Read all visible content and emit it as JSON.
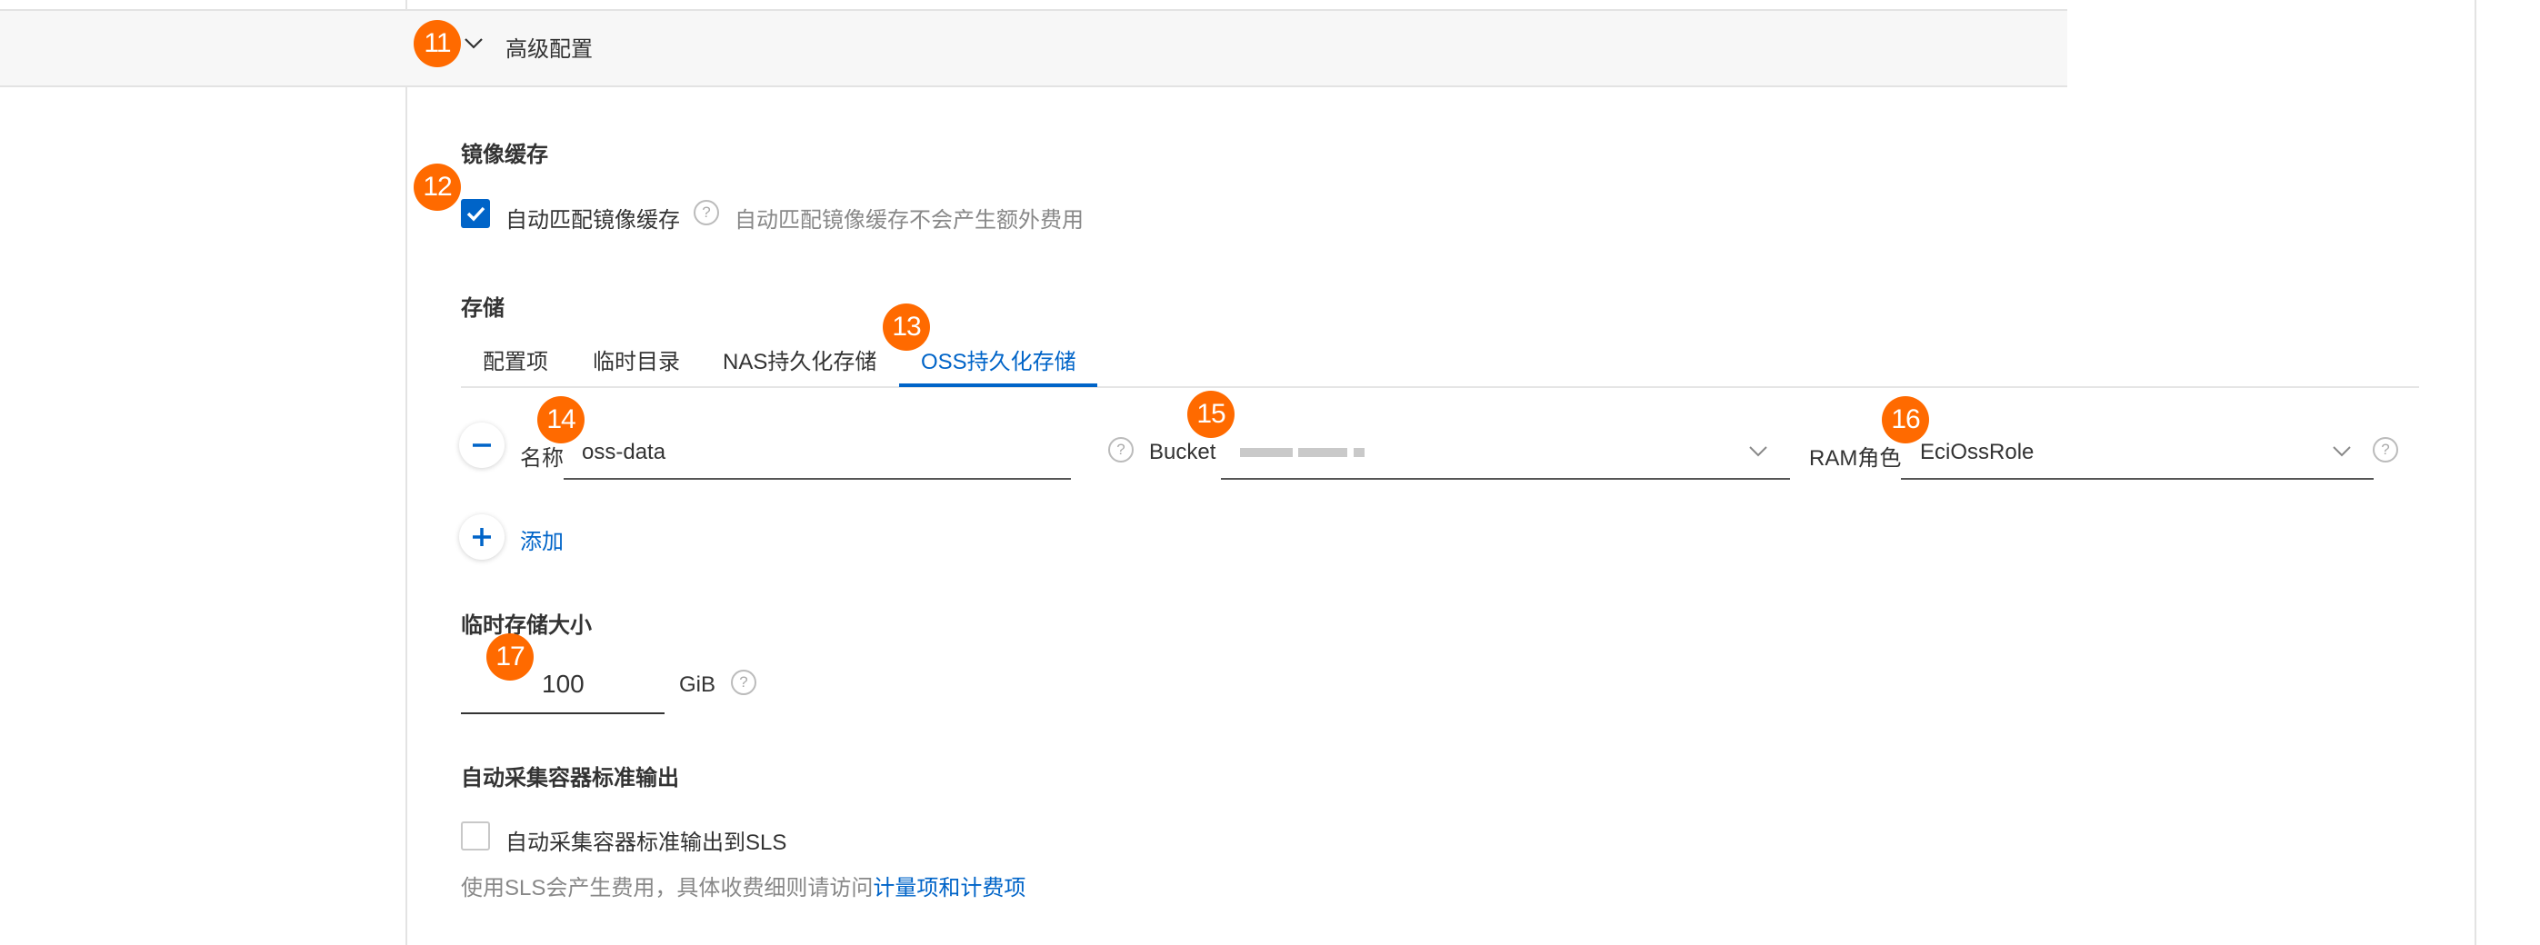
{
  "advanced": {
    "badge": "11",
    "title": "高级配置"
  },
  "image_cache": {
    "title": "镜像缓存",
    "badge": "12",
    "checkbox_label": "自动匹配镜像缓存",
    "checked": true,
    "help_text": "自动匹配镜像缓存不会产生额外费用"
  },
  "storage": {
    "title": "存储",
    "badge": "13",
    "tabs": [
      {
        "label": "配置项",
        "active": false
      },
      {
        "label": "临时目录",
        "active": false
      },
      {
        "label": "NAS持久化存储",
        "active": false
      },
      {
        "label": "OSS持久化存储",
        "active": true
      }
    ],
    "row": {
      "name_badge": "14",
      "name_label": "名称",
      "name_value": "oss-data",
      "bucket_badge": "15",
      "bucket_label": "Bucket",
      "ram_badge": "16",
      "ram_label": "RAM角色",
      "ram_value": "EciOssRole"
    },
    "add_label": "添加"
  },
  "temp_storage": {
    "title": "临时存储大小",
    "badge": "17",
    "value": "100",
    "unit": "GiB"
  },
  "stdout": {
    "title": "自动采集容器标准输出",
    "checkbox_label": "自动采集容器标准输出到SLS",
    "checked": false,
    "note_prefix": "使用SLS会产生费用，具体收费细则请访问",
    "note_link": "计量项和计费项"
  },
  "colors": {
    "accent": "#0064c8",
    "badge": "#ff6a00"
  }
}
